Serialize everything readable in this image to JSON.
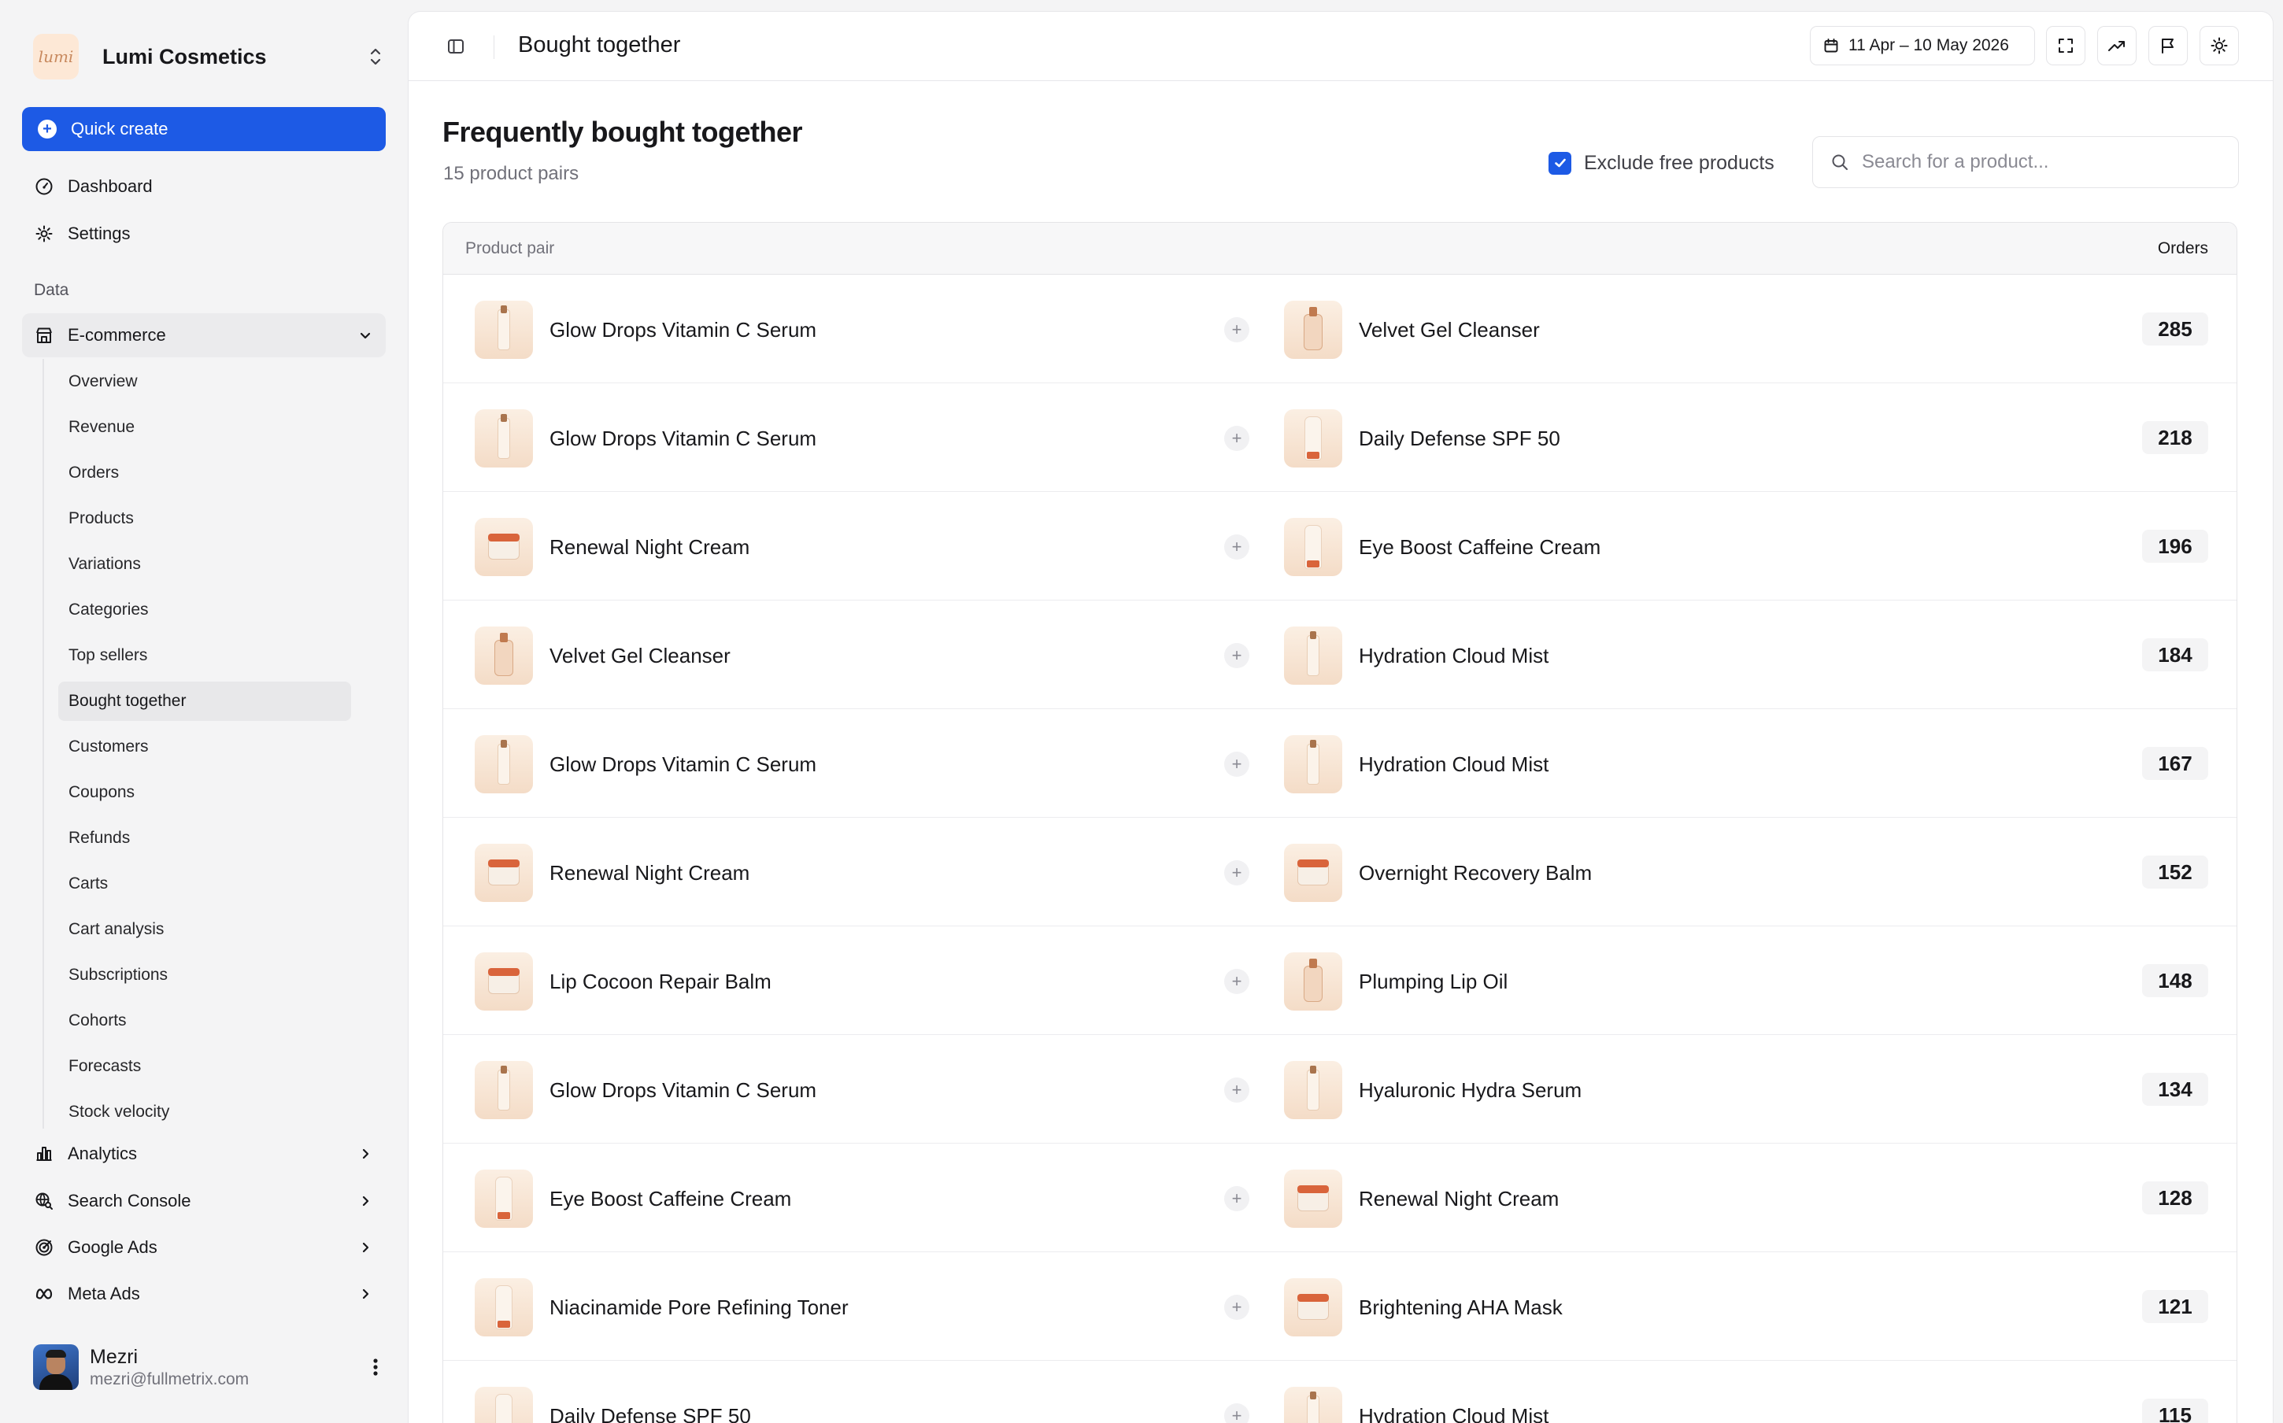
{
  "brand": {
    "logo_text": "lumi",
    "name": "Lumi Cosmetics"
  },
  "sidebar": {
    "quick_create": "Quick create",
    "dashboard": "Dashboard",
    "settings": "Settings",
    "section_label": "Data",
    "ecommerce": {
      "label": "E-commerce",
      "items": [
        "Overview",
        "Revenue",
        "Orders",
        "Products",
        "Variations",
        "Categories",
        "Top sellers",
        "Bought together",
        "Customers",
        "Coupons",
        "Refunds",
        "Carts",
        "Cart analysis",
        "Subscriptions",
        "Cohorts",
        "Forecasts",
        "Stock velocity"
      ],
      "active": "Bought together"
    },
    "groups": [
      {
        "label": "Analytics",
        "icon": "bar-chart-icon"
      },
      {
        "label": "Search Console",
        "icon": "globe-search-icon"
      },
      {
        "label": "Google Ads",
        "icon": "target-icon"
      },
      {
        "label": "Meta Ads",
        "icon": "meta-infinity-icon"
      }
    ],
    "user": {
      "name": "Mezri",
      "email": "mezri@fullmetrix.com"
    }
  },
  "header": {
    "title": "Bought together",
    "date_range": "11 Apr – 10 May 2026"
  },
  "page": {
    "title": "Frequently bought together",
    "subtitle": "15 product pairs",
    "exclude_label": "Exclude free products",
    "exclude_checked": true,
    "search_placeholder": "Search for a product...",
    "search_value": ""
  },
  "table": {
    "col_pair": "Product pair",
    "col_orders": "Orders",
    "rows": [
      {
        "a": "Glow Drops Vitamin C Serum",
        "a_img": "bottle",
        "b": "Velvet Gel Cleanser",
        "b_img": "pump",
        "orders": "285"
      },
      {
        "a": "Glow Drops Vitamin C Serum",
        "a_img": "bottle",
        "b": "Daily Defense SPF 50",
        "b_img": "tube",
        "orders": "218"
      },
      {
        "a": "Renewal Night Cream",
        "a_img": "jar",
        "b": "Eye Boost Caffeine Cream",
        "b_img": "tube",
        "orders": "196"
      },
      {
        "a": "Velvet Gel Cleanser",
        "a_img": "pump",
        "b": "Hydration Cloud Mist",
        "b_img": "bottle",
        "orders": "184"
      },
      {
        "a": "Glow Drops Vitamin C Serum",
        "a_img": "bottle",
        "b": "Hydration Cloud Mist",
        "b_img": "bottle",
        "orders": "167"
      },
      {
        "a": "Renewal Night Cream",
        "a_img": "jar",
        "b": "Overnight Recovery Balm",
        "b_img": "jar",
        "orders": "152"
      },
      {
        "a": "Lip Cocoon Repair Balm",
        "a_img": "jar",
        "b": "Plumping Lip Oil",
        "b_img": "pump",
        "orders": "148"
      },
      {
        "a": "Glow Drops Vitamin C Serum",
        "a_img": "bottle",
        "b": "Hyaluronic Hydra Serum",
        "b_img": "bottle",
        "orders": "134"
      },
      {
        "a": "Eye Boost Caffeine Cream",
        "a_img": "tube",
        "b": "Renewal Night Cream",
        "b_img": "jar",
        "orders": "128"
      },
      {
        "a": "Niacinamide Pore Refining Toner",
        "a_img": "tube",
        "b": "Brightening AHA Mask",
        "b_img": "jar",
        "orders": "121"
      },
      {
        "a": "Daily Defense SPF 50",
        "a_img": "tube",
        "b": "Hydration Cloud Mist",
        "b_img": "bottle",
        "orders": "115"
      }
    ]
  },
  "colors": {
    "accent": "#1d5ae5",
    "sidebar_bg": "#f4f4f5"
  }
}
